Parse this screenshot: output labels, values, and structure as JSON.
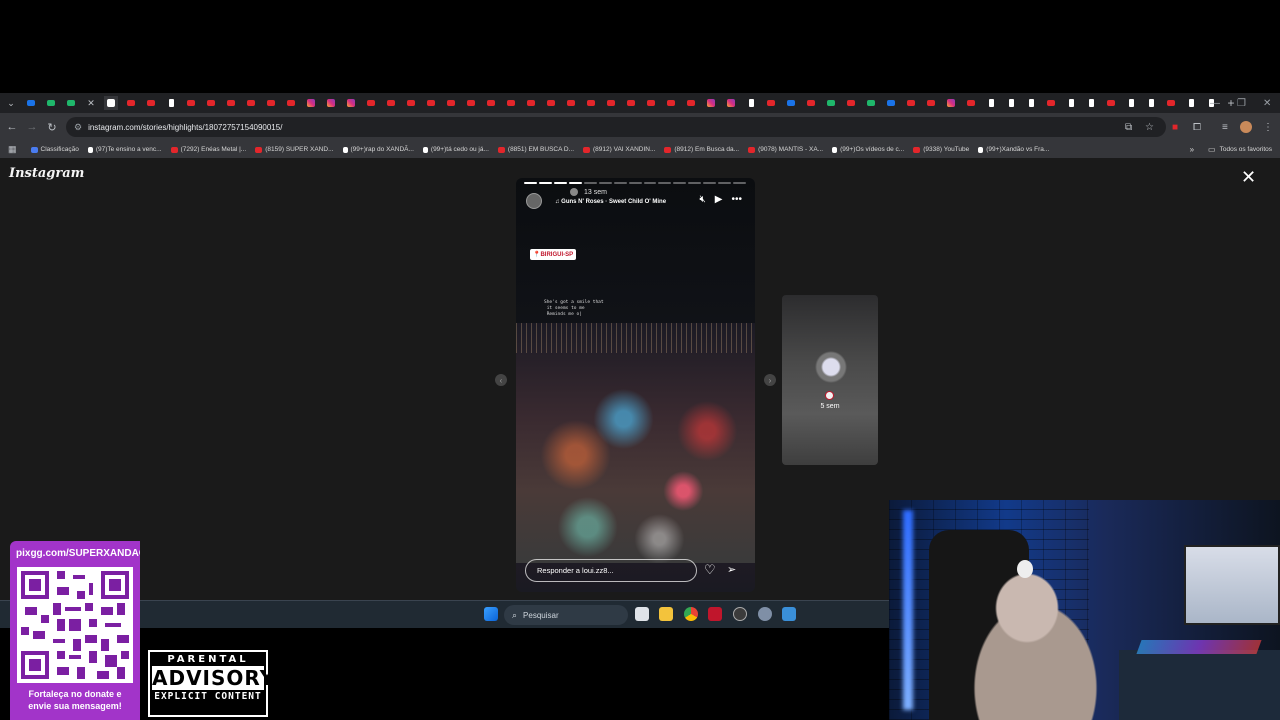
{
  "browser": {
    "url": "instagram.com/stories/highlights/18072757154090015/",
    "bookmarks": [
      {
        "label": "Classificação",
        "color": "#4a7cf0"
      },
      {
        "label": "(97)Te ensino a venc...",
        "color": "#ffffff"
      },
      {
        "label": "(7292) Enéas Metal |...",
        "color": "#e3262b"
      },
      {
        "label": "(8159) SUPER XAND...",
        "color": "#e3262b"
      },
      {
        "label": "(99+)rap do XANDÃ...",
        "color": "#ffffff"
      },
      {
        "label": "(99+)tá cedo ou já...",
        "color": "#ffffff"
      },
      {
        "label": "(8851) EM BUSCA D...",
        "color": "#e3262b"
      },
      {
        "label": "(8912) VAI XANDIN...",
        "color": "#e3262b"
      },
      {
        "label": "(8912) Em Busca da...",
        "color": "#e3262b"
      },
      {
        "label": "(9078) MANTIS - XA...",
        "color": "#e3262b"
      },
      {
        "label": "(99+)Os vídeos de c...",
        "color": "#ffffff"
      },
      {
        "label": "(9338) YouTube",
        "color": "#e3262b"
      },
      {
        "label": "(99+)Xandão vs Fra...",
        "color": "#ffffff"
      }
    ],
    "all_bookmarks": "Todos os favoritos"
  },
  "instagram": {
    "logo": "Instagram",
    "story": {
      "time": "13 sem",
      "music": "Guns N' Roses · Sweet Child O' Mine",
      "location_tag": "📍BIRIGUI-SP",
      "lyrics": "She's got a smile that\n it seems to me\n Reminds me o|",
      "reply_placeholder": "Responder a loui.zz8..."
    },
    "next_story": {
      "time": "5 sem"
    }
  },
  "taskbar": {
    "search_placeholder": "Pesquisar"
  },
  "overlay": {
    "donate_url": "pixgg.com/SUPERXANDAO",
    "donate_msg_1": "Fortaleça no donate e",
    "donate_msg_2": "envie sua mensagem!",
    "advisory_top": "PARENTAL",
    "advisory_mid": "ADVISORY",
    "advisory_bottom": "EXPLICIT CONTENT"
  },
  "colors": {
    "overlay_purple": "#a234c9",
    "youtube_red": "#e3262b",
    "ig_bg": "#1a1a1a"
  }
}
